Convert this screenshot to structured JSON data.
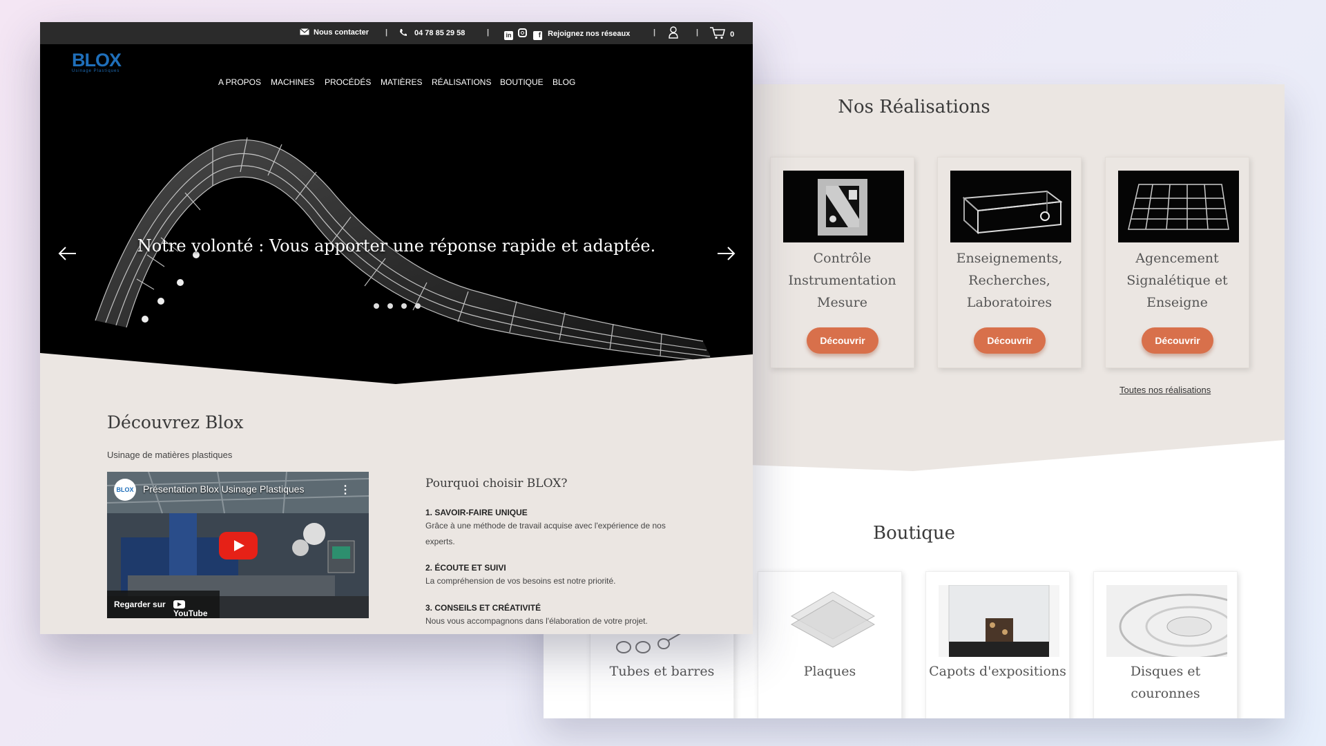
{
  "topbar": {
    "contact": "Nous contacter",
    "phone": "04 78 85 29 58",
    "social": "Rejoignez nos réseaux",
    "cart_count": "0",
    "separator": "|"
  },
  "logo": {
    "mark": "BLOX",
    "subtitle": "Usinage Plastiques"
  },
  "nav": [
    "A PROPOS",
    "MACHINES",
    "PROCÉDÉS",
    "MATIÈRES",
    "RÉALISATIONS",
    "BOUTIQUE",
    "BLOG"
  ],
  "hero": {
    "caption": "Notre volonté : Vous apporter une réponse rapide et adaptée.",
    "slides": 4
  },
  "discover": {
    "title": "Découvrez Blox",
    "subtitle": "Usinage de matières plastiques",
    "video": {
      "title": "Présentation Blox Usinage Plastiques",
      "logo_text": "BLOX",
      "watch_label": "Regarder sur",
      "platform": "YouTube"
    },
    "why_title": "Pourquoi choisir BLOX?",
    "points": [
      {
        "title": "1. SAVOIR-FAIRE UNIQUE",
        "text": "Grâce à une méthode de travail acquise avec l'expérience de nos experts."
      },
      {
        "title": "2. ÉCOUTE ET SUIVI",
        "text": "La compréhension de vos besoins est notre priorité."
      },
      {
        "title": "3. CONSEILS ET CRÉATIVITÉ",
        "text": "Nous vous accompagnons dans l'élaboration de votre projet."
      }
    ]
  },
  "realisations": {
    "title": "Nos Réalisations",
    "cards": [
      {
        "label": "Contrôle Instrumentation Mesure",
        "button": "Découvrir"
      },
      {
        "label": "Enseignements, Recherches, Laboratoires",
        "button": "Découvrir"
      },
      {
        "label": "Agencement Signalétique et Enseigne",
        "button": "Découvrir"
      }
    ],
    "all_link": "Toutes nos réalisations"
  },
  "boutique": {
    "title": "Boutique",
    "cards": [
      {
        "label": "Tubes et barres"
      },
      {
        "label": "Plaques"
      },
      {
        "label": "Capots d'expositions"
      },
      {
        "label": "Disques et couronnes"
      }
    ]
  },
  "colors": {
    "accent": "#d8704b",
    "brand": "#1f6fba",
    "topbar": "#2b2b2b",
    "section_bg": "#ebe6e2"
  }
}
